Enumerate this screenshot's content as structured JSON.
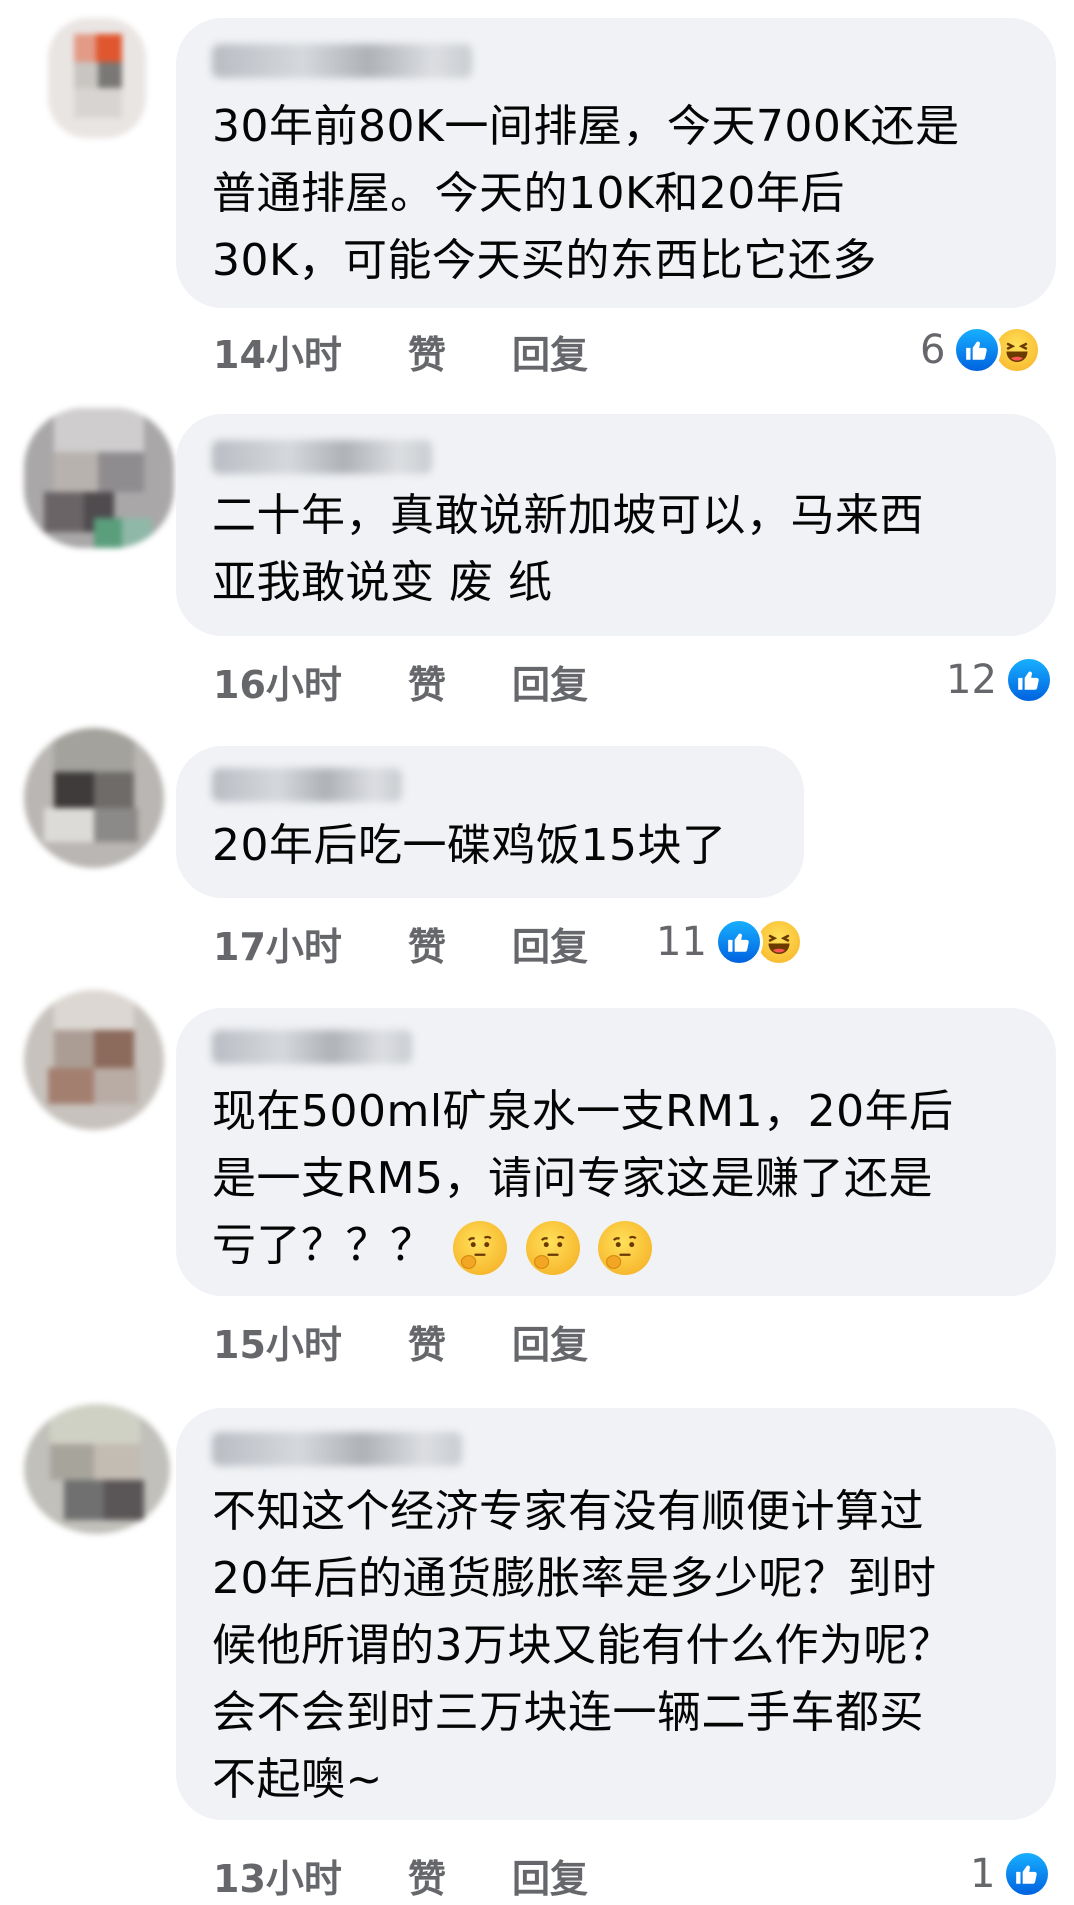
{
  "comments": [
    {
      "text": "30年前80K一间排屋，今天700K还是普通排屋。今天的10K和20年后30K，可能今天买的东西比它还多",
      "lines": [
        "30年前80K一间排屋，今天700K还是",
        "普通排屋。今天的10K和20年后",
        "30K，可能今天买的东西比它还多"
      ],
      "time": "14小时",
      "like": "赞",
      "reply": "回复",
      "reaction_count": "6",
      "reactions": [
        "like-icon",
        "haha-icon"
      ]
    },
    {
      "text": "二十年，真敢说新加坡可以，马来西亚我敢说变 废 纸",
      "lines": [
        "二十年，真敢说新加坡可以，马来西",
        "亚我敢说变 废 纸"
      ],
      "time": "16小时",
      "like": "赞",
      "reply": "回复",
      "reaction_count": "12",
      "reactions": [
        "like-icon"
      ]
    },
    {
      "text": "20年后吃一碟鸡饭15块了",
      "lines": [
        "20年后吃一碟鸡饭15块了"
      ],
      "time": "17小时",
      "like": "赞",
      "reply": "回复",
      "reaction_count": "11",
      "reactions": [
        "like-icon",
        "haha-icon"
      ]
    },
    {
      "text": "现在500ml矿泉水一支RM1，20年后是一支RM5，请问专家这是赚了还是亏了？？？",
      "lines": [
        "现在500ml矿泉水一支RM1，20年后",
        "是一支RM5，请问专家这是赚了还是",
        "亏了？？？"
      ],
      "emojis": [
        "thinking-face-icon",
        "thinking-face-icon",
        "thinking-face-icon"
      ],
      "time": "15小时",
      "like": "赞",
      "reply": "回复"
    },
    {
      "text": "不知这个经济专家有没有顺便计算过20年后的通货膨胀率是多少呢？到时候他所谓的3万块又能有什么作为呢？会不会到时三万块连一辆二手车都买不起噢~",
      "lines": [
        "不知这个经济专家有没有顺便计算过",
        "20年后的通货膨胀率是多少呢？到时",
        "候他所谓的3万块又能有什么作为呢？",
        "会不会到时三万块连一辆二手车都买",
        "不起噢~"
      ],
      "time": "13小时",
      "like": "赞",
      "reply": "回复",
      "reaction_count": "1",
      "reactions": [
        "like-icon"
      ]
    }
  ],
  "colors": {
    "bubble": "#f0f2f5",
    "meta_text": "#65676b",
    "like_blue": "#0866ff",
    "haha_yellow": "#f7b125"
  }
}
